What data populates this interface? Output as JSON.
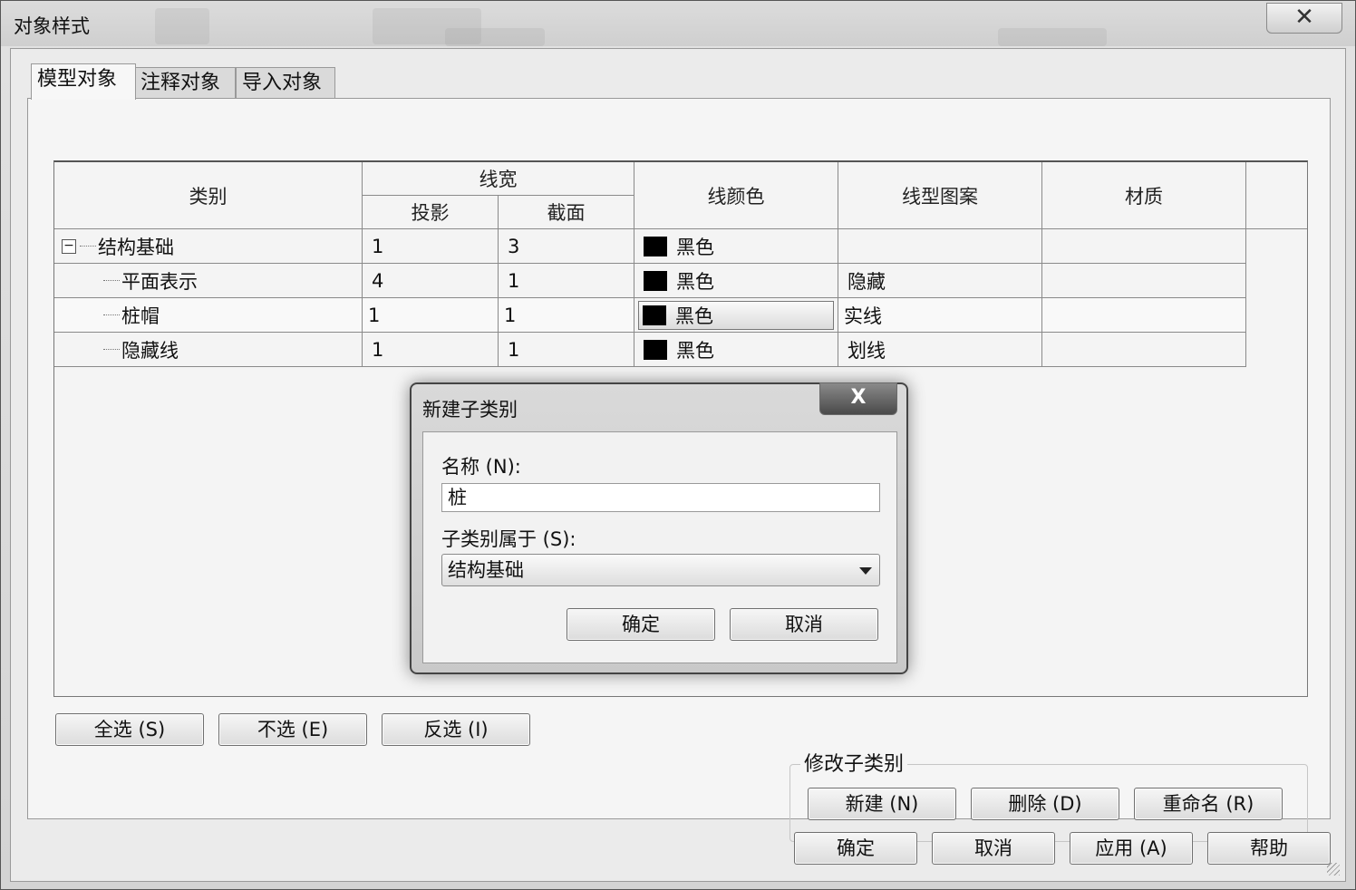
{
  "window": {
    "title": "对象样式",
    "close_glyph": "✕"
  },
  "tabs": [
    {
      "label": "模型对象",
      "active": true
    },
    {
      "label": "注释对象",
      "active": false
    },
    {
      "label": "导入对象",
      "active": false
    }
  ],
  "table": {
    "headers": {
      "category": "类别",
      "line_weight": "线宽",
      "projection": "投影",
      "cut": "截面",
      "line_color": "线颜色",
      "line_pattern": "线型图案",
      "material": "材质"
    },
    "rows": [
      {
        "name": "结构基础",
        "projection": "1",
        "cut": "3",
        "color": "黑色",
        "pattern": "",
        "material": "",
        "level": 0,
        "expanded": true
      },
      {
        "name": "平面表示",
        "projection": "4",
        "cut": "1",
        "color": "黑色",
        "pattern": "隐藏",
        "material": "",
        "level": 1
      },
      {
        "name": "桩帽",
        "projection": "1",
        "cut": "1",
        "color": "黑色",
        "pattern": "实线",
        "material": "",
        "level": 1,
        "selected": true
      },
      {
        "name": "隐藏线",
        "projection": "1",
        "cut": "1",
        "color": "黑色",
        "pattern": "划线",
        "material": "",
        "level": 1
      }
    ],
    "swatch_color": "#000000"
  },
  "selection_buttons": {
    "select_all": "全选 (S)",
    "select_none": "不选 (E)",
    "invert": "反选 (I)"
  },
  "subcategory_group": {
    "title": "修改子类别",
    "new": "新建 (N)",
    "delete": "删除 (D)",
    "rename": "重命名 (R)"
  },
  "footer_buttons": {
    "ok": "确定",
    "cancel": "取消",
    "apply": "应用 (A)",
    "help": "帮助"
  },
  "modal": {
    "title": "新建子类别",
    "close_glyph": "X",
    "name_label": "名称 (N):",
    "name_value": "桩",
    "parent_label": "子类别属于 (S):",
    "parent_value": "结构基础",
    "ok": "确定",
    "cancel": "取消"
  }
}
